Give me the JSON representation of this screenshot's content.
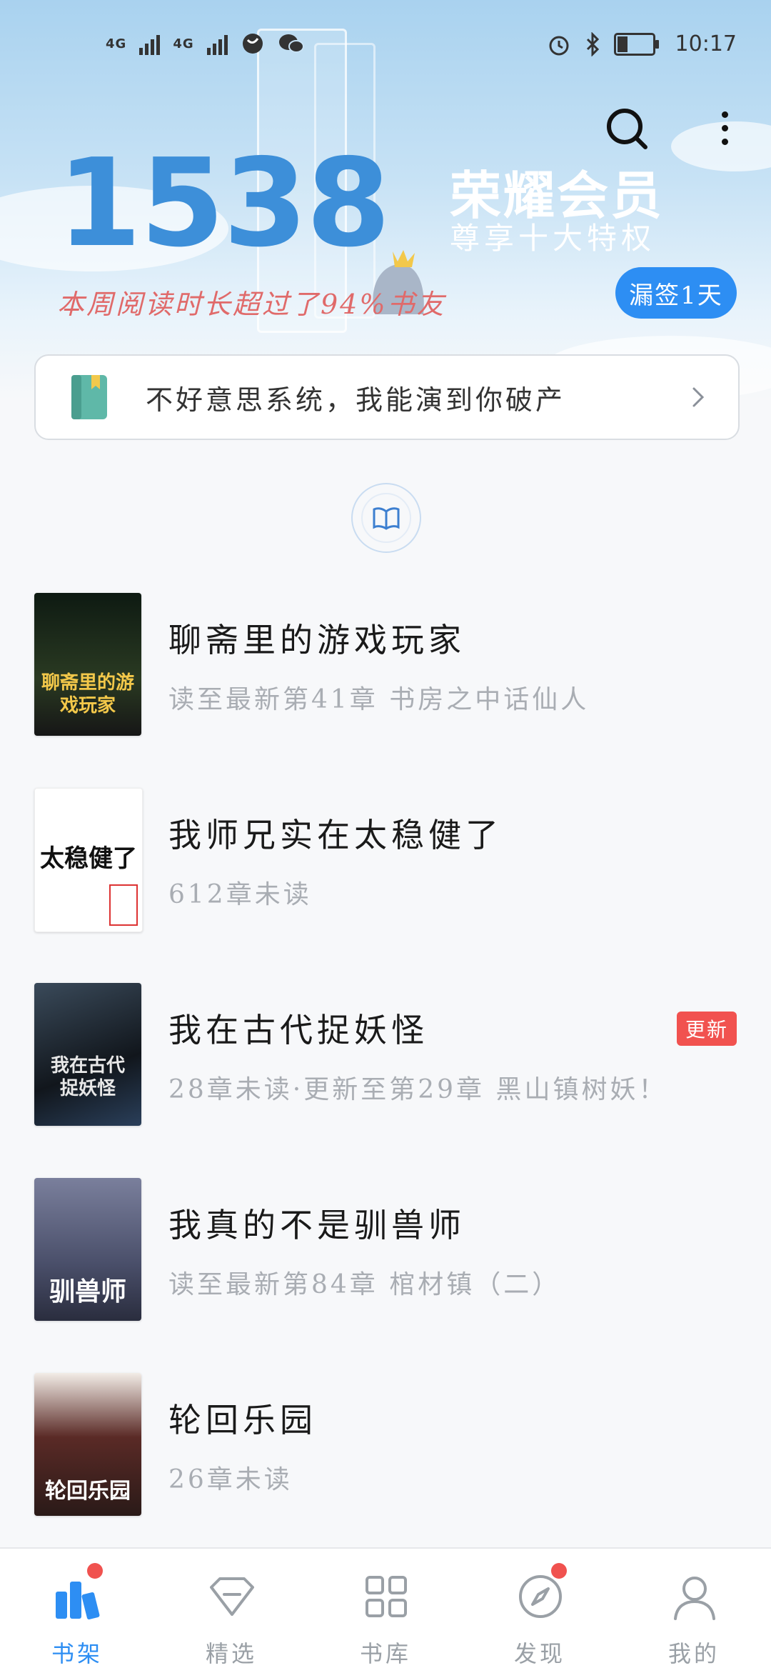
{
  "status_bar": {
    "signal1": "4G",
    "signal2": "4G",
    "time": "10:17"
  },
  "hero": {
    "reading_minutes": "1538",
    "stat_text": "本周阅读时长超过了94%书友",
    "vip_title": "荣耀会员",
    "vip_subtitle": "尊享十大特权",
    "checkin_label": "漏签1天"
  },
  "recommend": {
    "text": "不好意思系统，我能演到你破产"
  },
  "books": [
    {
      "title": "聊斋里的游戏玩家",
      "subtitle": "读至最新第41章 书房之中话仙人",
      "badge": "",
      "cover_text": "聊斋里的游戏玩家",
      "cover_color": "#1c2a1e"
    },
    {
      "title": "我师兄实在太稳健了",
      "subtitle": "612章未读",
      "badge": "",
      "cover_text": "太稳健了",
      "cover_color": "#ffffff"
    },
    {
      "title": "我在古代捉妖怪",
      "subtitle": "28章未读·更新至第29章 黑山镇树妖！",
      "badge": "更新",
      "cover_text": "我在古代捉妖怪",
      "cover_color": "#1f242a"
    },
    {
      "title": "我真的不是驯兽师",
      "subtitle": "读至最新第84章 棺材镇（二）",
      "badge": "",
      "cover_text": "驯兽师",
      "cover_color": "#4a4f6a"
    },
    {
      "title": "轮回乐园",
      "subtitle": "26章未读",
      "badge": "",
      "cover_text": "轮回乐园",
      "cover_color": "#3a2a26"
    }
  ],
  "tabs": [
    {
      "label": "书架",
      "icon": "bookshelf-icon",
      "active": true
    },
    {
      "label": "精选",
      "icon": "diamond-icon",
      "active": false
    },
    {
      "label": "书库",
      "icon": "grid-icon",
      "active": false
    },
    {
      "label": "发现",
      "icon": "compass-icon",
      "active": false
    },
    {
      "label": "我的",
      "icon": "person-icon",
      "active": false
    }
  ],
  "colors": {
    "accent": "#2d8ef3",
    "badge": "#f1524f",
    "stat": "#e06a6a"
  }
}
